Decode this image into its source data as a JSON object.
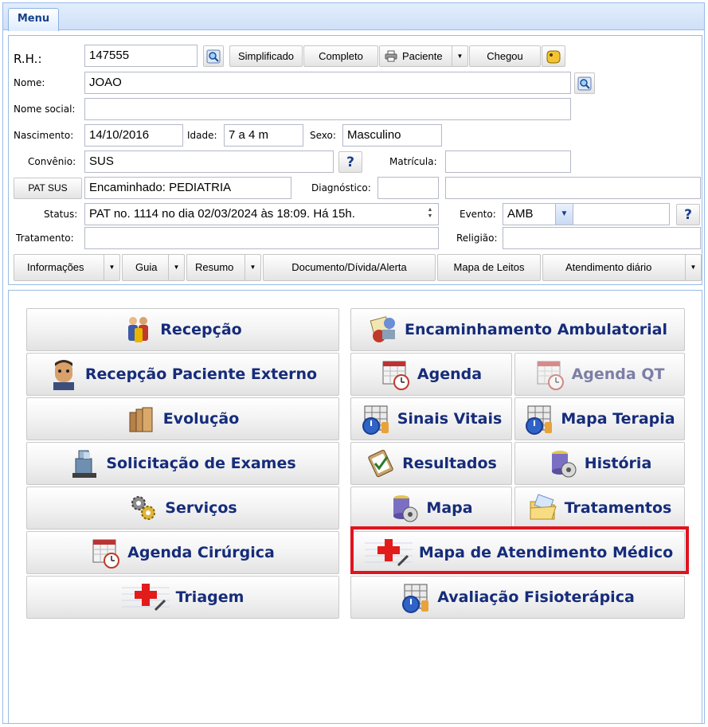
{
  "tabs": [
    {
      "label": "Menu"
    }
  ],
  "form": {
    "rh": {
      "label": "R.H.:",
      "value": "147555"
    },
    "buttons": {
      "simplificado": "Simplificado",
      "completo": "Completo",
      "paciente": "Paciente",
      "chegou": "Chegou"
    },
    "nome": {
      "label": "Nome:",
      "value": "JOAO"
    },
    "nome_social": {
      "label": "Nome social:",
      "value": ""
    },
    "nascimento": {
      "label": "Nascimento:",
      "value": "14/10/2016"
    },
    "idade": {
      "label": "Idade:",
      "value": "7 a 4 m"
    },
    "sexo": {
      "label": "Sexo:",
      "value": "Masculino"
    },
    "convenio": {
      "label": "Convênio:",
      "value": "SUS"
    },
    "matricula": {
      "label": "Matrícula:",
      "value": ""
    },
    "pat_sus": {
      "label": "PAT SUS",
      "value": "Encaminhado: PEDIATRIA"
    },
    "diagnostico": {
      "label": "Diagnóstico:",
      "value": "",
      "extra": ""
    },
    "status": {
      "label": "Status:",
      "value": "PAT no. 1114 no dia 02/03/2024  às  18:09. Há 15h."
    },
    "evento": {
      "label": "Evento:",
      "value": "AMB",
      "extra": ""
    },
    "tratamento": {
      "label": "Tratamento:",
      "value": ""
    },
    "religiao": {
      "label": "Religião:",
      "value": ""
    },
    "help_label": "?"
  },
  "toolbar": {
    "informacoes": "Informações",
    "guia": "Guia",
    "resumo": "Resumo",
    "documento": "Documento/Dívida/Alerta",
    "mapa_leitos": "Mapa de Leitos",
    "atendimento_diario": "Atendimento diário"
  },
  "menu": {
    "recepcao": "Recepção",
    "encaminhamento": "Encaminhamento Ambulatorial",
    "recepcao_externo": "Recepção Paciente Externo",
    "agenda": "Agenda",
    "agenda_qt": "Agenda QT",
    "evolucao": "Evolução",
    "sinais_vitais": "Sinais Vitais",
    "mapa_terapia": "Mapa Terapia",
    "solicitacao_exames": "Solicitação de Exames",
    "resultados": "Resultados",
    "historia": "História",
    "servicos": "Serviços",
    "mapa": "Mapa",
    "tratamentos": "Tratamentos",
    "agenda_cirurgica": "Agenda Cirúrgica",
    "mapa_atendimento": "Mapa de Atendimento Médico",
    "triagem": "Triagem",
    "avaliacao_fisio": "Avaliação Fisioterápica"
  },
  "colors": {
    "accent": "#15428b",
    "menu_text": "#162c7a",
    "highlight": "#e0141e",
    "disabled_text": "#7d7ea6"
  }
}
